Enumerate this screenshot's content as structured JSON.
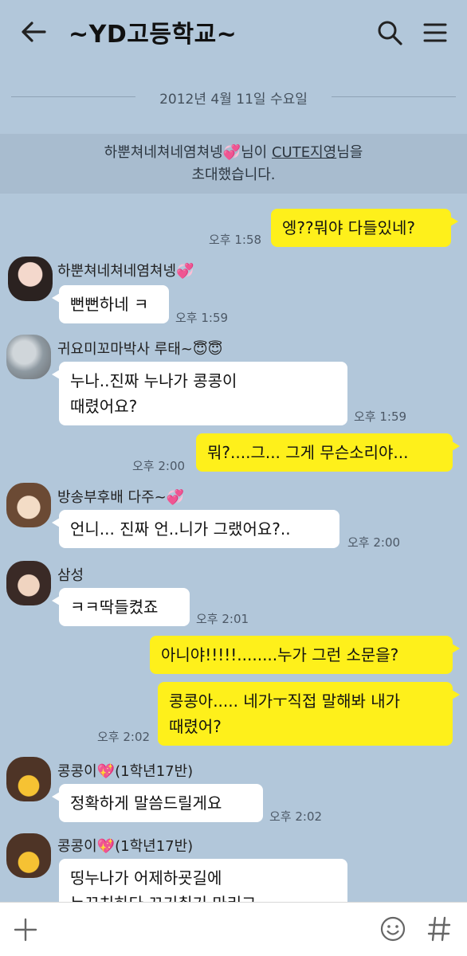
{
  "header": {
    "title": "~YD고등학교~"
  },
  "date_divider": "2012년 4월 11일 수요일",
  "system_message": {
    "line1_pre": "하뿐쳐네쳐네염쳐넹",
    "line1_mid": "님이 ",
    "line1_link": "CUTE지영",
    "line1_post": "님을",
    "line2": "초대했습니다."
  },
  "messages": [
    {
      "id": "m1",
      "side": "me",
      "text": "엥??뭐야 다들있네?",
      "time": "오후 1:58"
    },
    {
      "id": "m2",
      "side": "other",
      "sender": "하뿐쳐네쳐네염쳐넹",
      "text": "뻔뻔하네 ㅋ",
      "time": "오후 1:59"
    },
    {
      "id": "m3",
      "side": "other",
      "sender": "귀요미꼬마박사 루태~",
      "line1": "누나..진짜 누나가 콩콩이",
      "line2": "때렸어요?",
      "time": "오후 1:59"
    },
    {
      "id": "m4",
      "side": "me",
      "text": "뭐?....그... 그게 무슨소리야...",
      "time": "오후 2:00"
    },
    {
      "id": "m5",
      "side": "other",
      "sender": "방송부후배 다주~",
      "text": "언니... 진짜 언..니가 그랬어요?..",
      "time": "오후 2:00"
    },
    {
      "id": "m6",
      "side": "other",
      "sender": "삼성",
      "text": "ㅋㅋ딱들켰죠",
      "time": "오후 2:01"
    },
    {
      "id": "m7",
      "side": "me",
      "text": "아니야!!!!!........누가 그런 소문을?"
    },
    {
      "id": "m8",
      "side": "me",
      "line1": "콩콩아..... 네가ㅜ직접 말해봐 내가",
      "line2": "때렸어?",
      "time": "오후 2:02"
    },
    {
      "id": "m9",
      "side": "other",
      "sender": "콩콩이",
      "sender_suffix": "(1학년17반)",
      "text": "정확하게 말씀드릴게요",
      "time": "오후 2:02"
    },
    {
      "id": "m10",
      "side": "other",
      "sender": "콩콩이",
      "sender_suffix": "(1학년17반)",
      "line1": "띵누나가 어제하굣길에",
      "line2": "누꼬치하다 끄기취기 마리그"
    }
  ],
  "emoji": {
    "heart": "💞",
    "sparkle_heart": "💖",
    "angel": "😇"
  },
  "input": {
    "placeholder": ""
  },
  "icons": {
    "back": "back-arrow-icon",
    "search": "search-icon",
    "menu": "hamburger-menu-icon",
    "plus": "plus-icon",
    "emoticon": "smiley-icon",
    "hash": "hash-icon"
  },
  "colors": {
    "background": "#b2c7da",
    "my_bubble": "#fef01b",
    "other_bubble": "#ffffff"
  }
}
